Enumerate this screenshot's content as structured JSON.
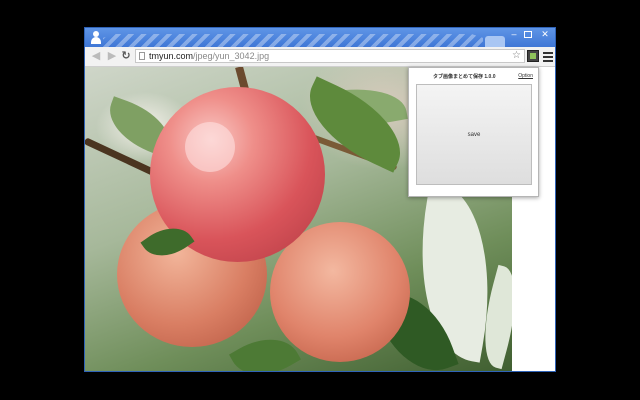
{
  "browser": {
    "address_bar": {
      "url_host": "tmyun.com",
      "url_path": "/jpeg/yun_3042.jpg"
    },
    "window_controls": {
      "minimize": "–",
      "close": "✕"
    },
    "icons": {
      "back": "back-arrow-icon",
      "forward": "forward-arrow-icon",
      "reload": "reload-icon",
      "bookmark": "star-icon",
      "extension": "extension-icon",
      "menu": "hamburger-menu-icon",
      "profile": "profile-icon"
    }
  },
  "popup": {
    "title": "タブ画像まとめて保存 1.0.0",
    "option_link": "Option",
    "save_button": "save"
  },
  "page": {
    "content": "peach photograph"
  }
}
